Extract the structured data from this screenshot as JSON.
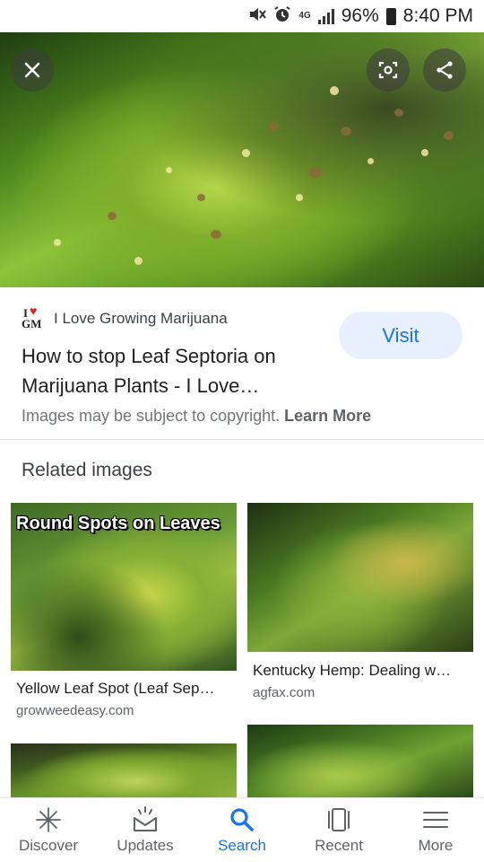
{
  "status_bar": {
    "battery": "96%",
    "time": "8:40 PM"
  },
  "hero": {
    "close_label": "Close",
    "lens_label": "Search inside image",
    "share_label": "Share"
  },
  "result": {
    "source_name": "I Love Growing Marijuana",
    "logo_text": "I GM",
    "title": "How to stop Leaf Septoria on Marijuana Plants - I Love…",
    "visit_label": "Visit",
    "copyright_text": "Images may be subject to copyright.",
    "learn_more": "Learn More"
  },
  "related": {
    "heading": "Related images",
    "items": [
      {
        "overlay_text": "Round Spots on Leaves",
        "title": "Yellow Leaf Spot (Leaf Sep…",
        "source": "growweedeasy.com"
      },
      {
        "title": "Kentucky Hemp: Dealing w…",
        "source": "agfax.com"
      },
      {},
      {}
    ]
  },
  "bottom_nav": {
    "items": [
      {
        "label": "Discover",
        "icon": "discover-asterisk-icon"
      },
      {
        "label": "Updates",
        "icon": "updates-tray-icon"
      },
      {
        "label": "Search",
        "icon": "search-icon",
        "active": true
      },
      {
        "label": "Recent",
        "icon": "recent-cards-icon"
      },
      {
        "label": "More",
        "icon": "menu-icon"
      }
    ]
  },
  "colors": {
    "accent": "#1a73e8",
    "visit_bg": "#e8f0fe",
    "muted_text": "#70757a"
  }
}
